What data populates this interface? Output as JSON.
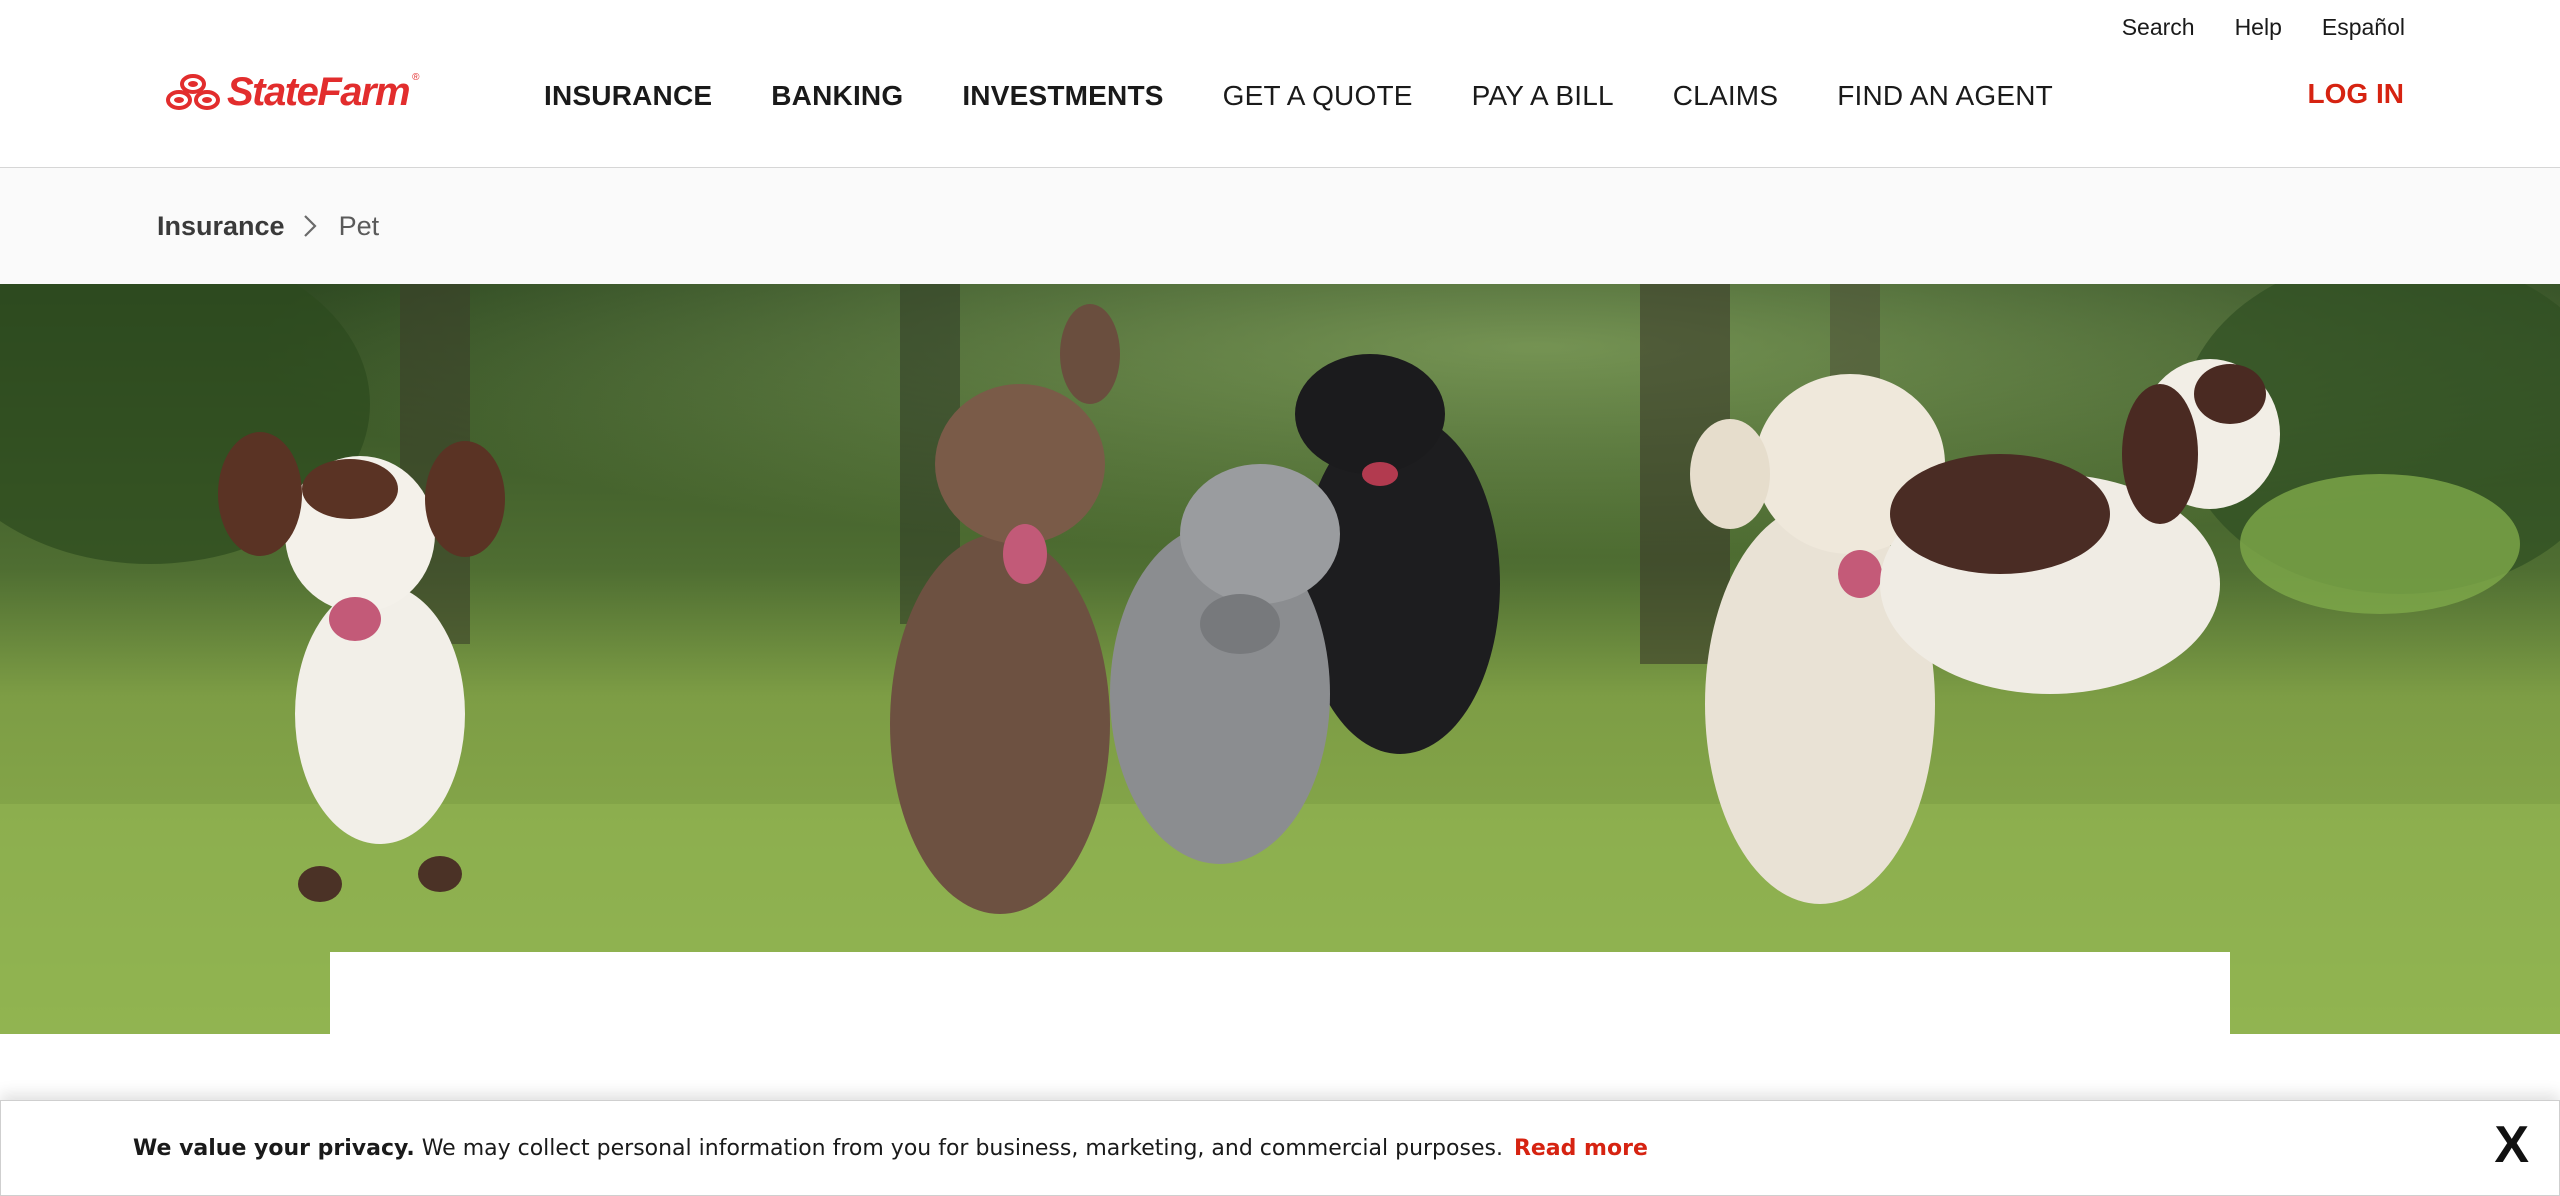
{
  "utility_nav": [
    "Search",
    "Help",
    "Español"
  ],
  "logo": {
    "text": "StateFarm",
    "reg": "®"
  },
  "main_nav": [
    "INSURANCE",
    "BANKING",
    "INVESTMENTS",
    "GET A QUOTE",
    "PAY A BILL",
    "CLAIMS",
    "FIND AN AGENT"
  ],
  "login_label": "LOG IN",
  "breadcrumb": {
    "parent": "Insurance",
    "current": "Pet"
  },
  "hero": {
    "image_alt_icon": "dogs-running-photo"
  },
  "privacy": {
    "lead": "We value your privacy.",
    "body": "We may collect personal information from you for business, marketing, and commercial purposes.",
    "link": "Read more",
    "close": "X"
  },
  "colors": {
    "brand_red": "#e22d2d",
    "link_red": "#d62311",
    "text": "#1a1a1a"
  }
}
